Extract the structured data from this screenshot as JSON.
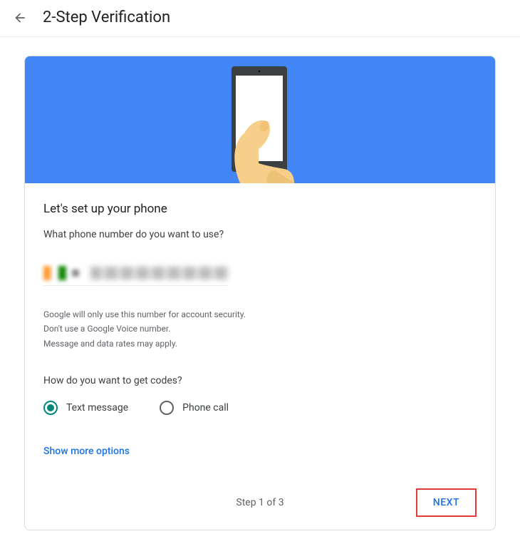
{
  "header": {
    "title": "2-Step Verification"
  },
  "main": {
    "heading": "Let's set up your phone",
    "question": "What phone number do you want to use?",
    "disclaimer": {
      "line1": "Google will only use this number for account security.",
      "line2": "Don't use a Google Voice number.",
      "line3": "Message and data rates may apply."
    },
    "codes_question": "How do you want to get codes?",
    "radio": {
      "option1": "Text message",
      "option2": "Phone call"
    },
    "show_more": "Show more options",
    "step_indicator": "Step 1 of 3",
    "next_button": "NEXT"
  }
}
